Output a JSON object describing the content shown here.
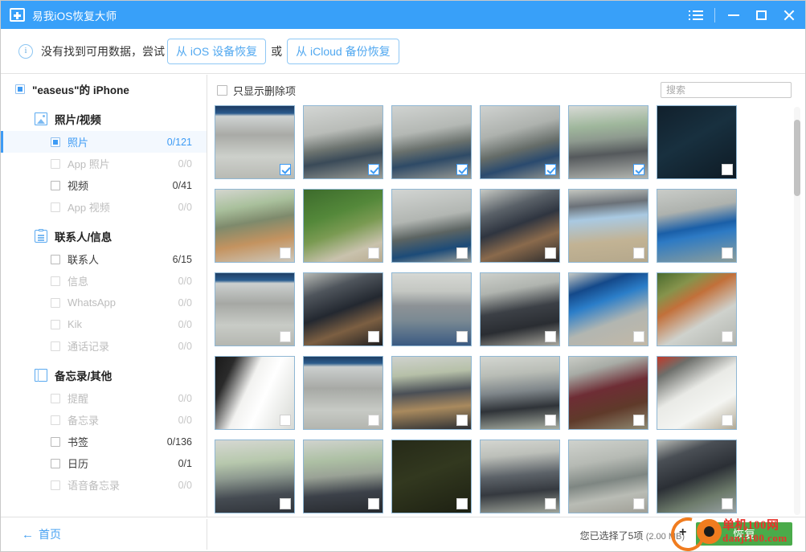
{
  "window": {
    "title": "易我iOS恢复大师",
    "app_icon": "briefcase-plus-icon",
    "controls": {
      "menu_label": "菜单",
      "minimize_label": "最小化",
      "maximize_label": "最大化",
      "close_label": "关闭"
    }
  },
  "notice": {
    "icon": "info-icon",
    "text_before": "没有找到可用数据，尝试",
    "button_ios": "从 iOS 设备恢复",
    "separator": "或",
    "button_icloud": "从 iCloud 备份恢复"
  },
  "sidebar": {
    "device": {
      "label": "\"easeus\"的 iPhone",
      "state": "selected"
    },
    "groups": [
      {
        "label": "照片/视频",
        "icon": "photo-icon",
        "items": [
          {
            "label": "照片",
            "count": "0/121",
            "selected": true,
            "disabled": false
          },
          {
            "label": "App 照片",
            "count": "0/0",
            "selected": false,
            "disabled": true
          },
          {
            "label": "视频",
            "count": "0/41",
            "selected": false,
            "disabled": false
          },
          {
            "label": "App 视频",
            "count": "0/0",
            "selected": false,
            "disabled": true
          }
        ]
      },
      {
        "label": "联系人/信息",
        "icon": "contacts-icon",
        "items": [
          {
            "label": "联系人",
            "count": "6/15",
            "selected": false,
            "disabled": false
          },
          {
            "label": "信息",
            "count": "0/0",
            "selected": false,
            "disabled": true
          },
          {
            "label": "WhatsApp",
            "count": "0/0",
            "selected": false,
            "disabled": true
          },
          {
            "label": "Kik",
            "count": "0/0",
            "selected": false,
            "disabled": true
          },
          {
            "label": "通话记录",
            "count": "0/0",
            "selected": false,
            "disabled": true
          }
        ]
      },
      {
        "label": "备忘录/其他",
        "icon": "note-icon",
        "items": [
          {
            "label": "提醒",
            "count": "0/0",
            "selected": false,
            "disabled": true
          },
          {
            "label": "备忘录",
            "count": "0/0",
            "selected": false,
            "disabled": true
          },
          {
            "label": "书签",
            "count": "0/136",
            "selected": false,
            "disabled": false
          },
          {
            "label": "日历",
            "count": "0/1",
            "selected": false,
            "disabled": false
          },
          {
            "label": "语音备忘录",
            "count": "0/0",
            "selected": false,
            "disabled": true
          }
        ]
      }
    ]
  },
  "content": {
    "filter_checkbox_label": "只显示删除项",
    "filter_checked": false,
    "search_placeholder": "搜索",
    "search_value": "",
    "thumbnails": [
      {
        "checked": true,
        "desc": "office-monitor-shelf"
      },
      {
        "checked": true,
        "desc": "office-desk-monitor"
      },
      {
        "checked": true,
        "desc": "office-desk-monitor-2"
      },
      {
        "checked": true,
        "desc": "office-desk-monitor-3"
      },
      {
        "checked": true,
        "desc": "office-people-desks"
      },
      {
        "checked": false,
        "desc": "dark-navy-frame"
      },
      {
        "checked": false,
        "desc": "office-green-wall-plant"
      },
      {
        "checked": false,
        "desc": "green-plant-closeup"
      },
      {
        "checked": false,
        "desc": "office-machine-monitor"
      },
      {
        "checked": false,
        "desc": "hand-pointing-monitor"
      },
      {
        "checked": false,
        "desc": "desk-keyboard-monitor"
      },
      {
        "checked": false,
        "desc": "blue-screen-monitor"
      },
      {
        "checked": false,
        "desc": "office-monitor-shelf-2"
      },
      {
        "checked": false,
        "desc": "dark-monitor-hand"
      },
      {
        "checked": false,
        "desc": "office-ceiling-people"
      },
      {
        "checked": false,
        "desc": "office-chair-person"
      },
      {
        "checked": false,
        "desc": "blue-windows-monitor"
      },
      {
        "checked": false,
        "desc": "blurred-green-orange"
      },
      {
        "checked": false,
        "desc": "motion-blur-white"
      },
      {
        "checked": false,
        "desc": "office-monitor-shelf-3"
      },
      {
        "checked": false,
        "desc": "office-desk-person"
      },
      {
        "checked": false,
        "desc": "office-standing-person"
      },
      {
        "checked": false,
        "desc": "person-maroon-hoodie"
      },
      {
        "checked": false,
        "desc": "white-paper-sheet"
      },
      {
        "checked": false,
        "desc": "office-green-wall-people"
      },
      {
        "checked": false,
        "desc": "office-man-screen"
      },
      {
        "checked": false,
        "desc": "dark-olive-frame"
      },
      {
        "checked": false,
        "desc": "office-chair-desks"
      },
      {
        "checked": false,
        "desc": "machine-close-up"
      },
      {
        "checked": false,
        "desc": "large-dark-monitor"
      }
    ],
    "scrollbar": {
      "position_percent": 3
    }
  },
  "footer": {
    "home_link": "首页",
    "home_arrow": "←",
    "selection_text": "您已选择了5项",
    "selection_size": "(2.00 MB)",
    "recover_button": "恢复"
  },
  "watermark": {
    "top_text": "单机100网",
    "bottom_text": "danji100.com"
  },
  "colors": {
    "titlebar": "#38a0f9",
    "accent": "#3d9bf5",
    "recover_green": "#4aab4a",
    "watermark_red": "#e8322a",
    "watermark_orange": "#f07c1f"
  }
}
